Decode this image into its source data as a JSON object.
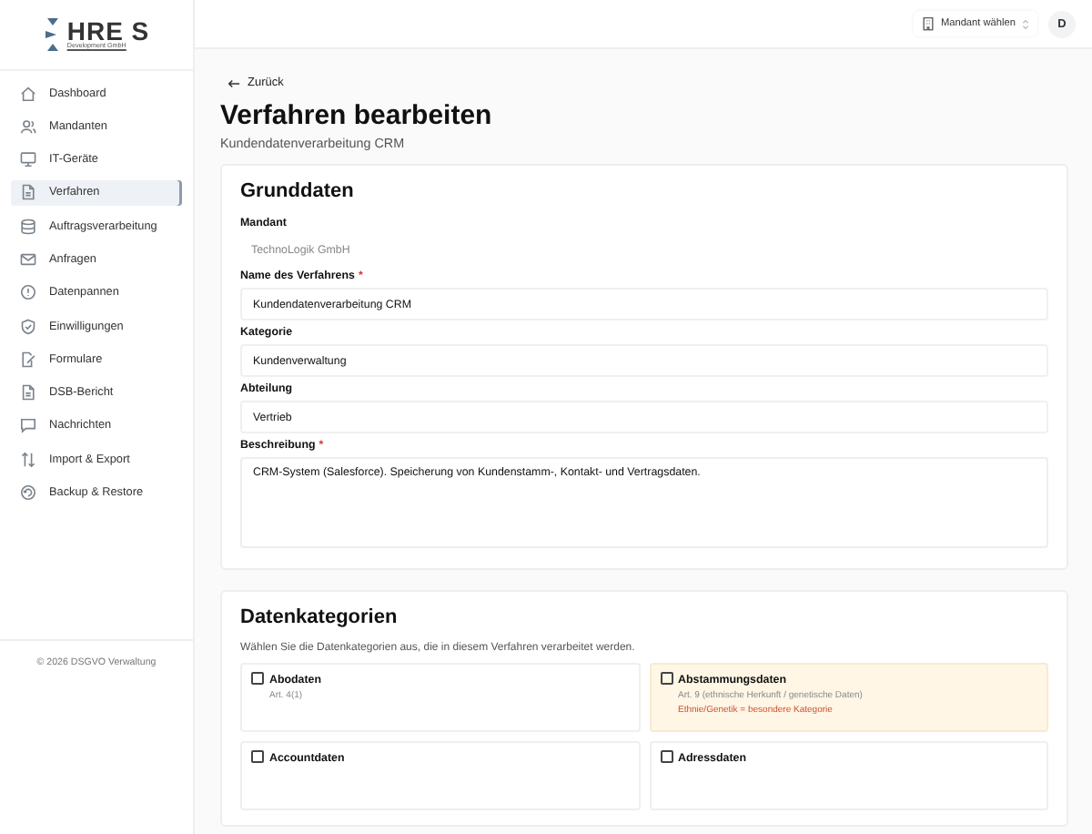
{
  "logo": {
    "title": "HRE S",
    "subtitle": "Development GmbH"
  },
  "sidebar": {
    "items": [
      {
        "label": "Dashboard",
        "selected": false
      },
      {
        "label": "Mandanten",
        "selected": false
      },
      {
        "label": "IT-Geräte",
        "selected": false
      },
      {
        "label": "Verfahren",
        "selected": true
      },
      {
        "label": "Auftragsverarbeitung",
        "selected": false
      },
      {
        "label": "Anfragen",
        "selected": false
      },
      {
        "label": "Datenpannen",
        "selected": false
      },
      {
        "label": "Einwilligungen",
        "selected": false
      },
      {
        "label": "Formulare",
        "selected": false
      },
      {
        "label": "DSB-Bericht",
        "selected": false
      },
      {
        "label": "Nachrichten",
        "selected": false
      },
      {
        "label": "Import & Export",
        "selected": false
      },
      {
        "label": "Backup & Restore",
        "selected": false
      }
    ],
    "footer": "© 2026 DSGVO Verwaltung"
  },
  "header": {
    "client_selector": "Mandant wählen",
    "avatar": "D"
  },
  "back_link": "Zurück",
  "page_title": "Verfahren bearbeiten",
  "page_subtitle": "Kundendatenverarbeitung CRM",
  "basic_data": {
    "title": "Grunddaten",
    "fields": [
      {
        "label": "Mandant",
        "kind": "readonly",
        "value": "TechnoLogik GmbH"
      },
      {
        "label": "Name des Verfahrens",
        "required_mark": "*",
        "kind": "input",
        "value": "Kundendatenverarbeitung CRM"
      },
      {
        "label": "Kategorie",
        "kind": "input",
        "value": "Kundenverwaltung"
      },
      {
        "label": "Abteilung",
        "kind": "input",
        "value": "Vertrieb"
      },
      {
        "label": "Beschreibung",
        "required_mark": "*",
        "kind": "textarea",
        "value": "CRM-System (Salesforce). Speicherung von Kundenstamm-, Kontakt- und Vertragsdaten."
      }
    ]
  },
  "data_categories": {
    "title": "Datenkategorien",
    "hint": "Wählen Sie die Datenkategorien aus, die in diesem Verfahren verarbeitet werden.",
    "items": [
      {
        "label": "Abodaten",
        "checked": false,
        "kind": "normal",
        "article": "Art. 4(1)"
      },
      {
        "label": "Abstammungsdaten",
        "checked": false,
        "kind": "special",
        "article": "Art. 9 (ethnische Herkunft / genetische Daten)",
        "warning": "Ethnie/Genetik = besondere Kategorie"
      },
      {
        "label": "Accountdaten",
        "checked": false,
        "kind": "normal"
      },
      {
        "label": "Adressdaten",
        "checked": false,
        "kind": "normal"
      }
    ]
  }
}
